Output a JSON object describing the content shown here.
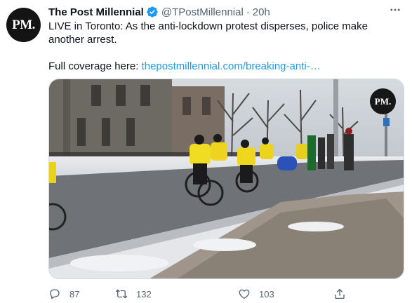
{
  "tweet": {
    "avatar_text": "PM.",
    "display_name": "The Post Millennial",
    "handle": "@TPostMillennial",
    "separator": "·",
    "time": "20h",
    "text_line": "LIVE in Toronto: As the anti-lockdown protest disperses, police make another arrest.",
    "coverage_prefix": "Full coverage here: ",
    "coverage_link": "thepostmillennial.com/breaking-anti-…",
    "media_watermark": "PM.",
    "reply_count": "87",
    "retweet_count": "132",
    "like_count": "103"
  },
  "colors": {
    "link": "#1d9bf0",
    "verified": "#1d9bf0",
    "secondary_text": "#536471"
  },
  "icons": [
    "verified-badge-icon",
    "more-options-icon",
    "reply-icon",
    "retweet-icon",
    "like-icon",
    "share-icon"
  ]
}
